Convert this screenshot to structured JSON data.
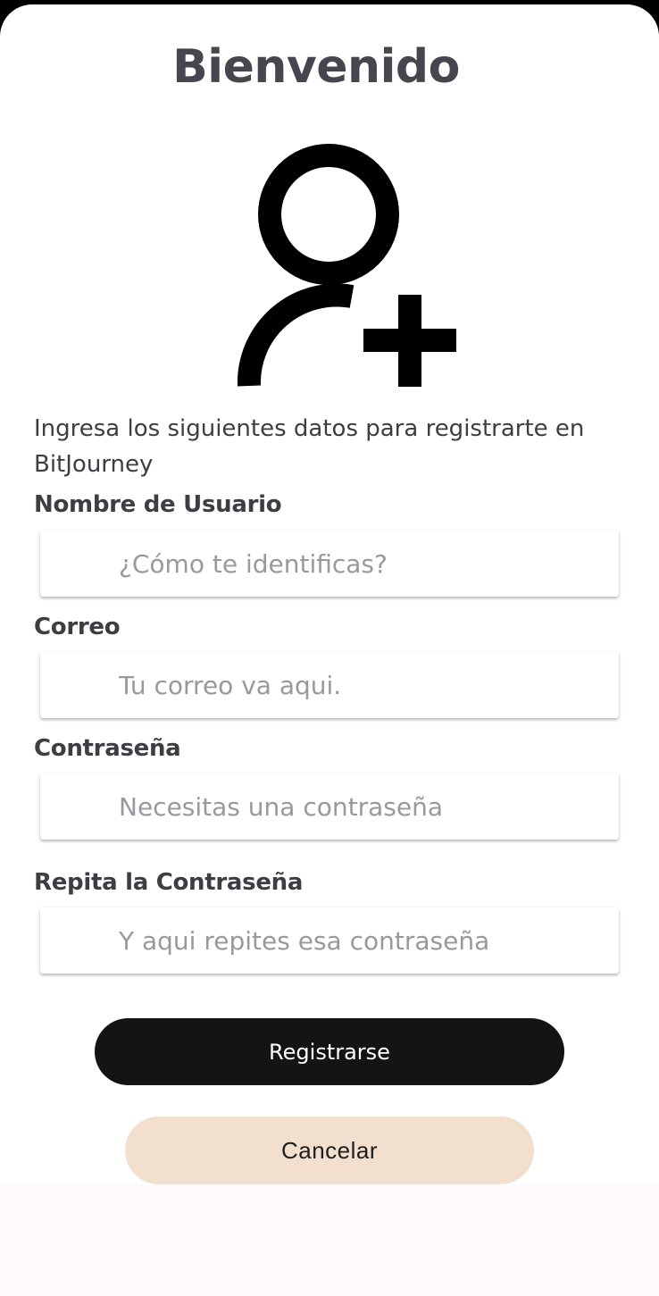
{
  "header": {
    "title": "Bienvenido"
  },
  "icon": {
    "name": "add-user-icon"
  },
  "intro_text": "Ingresa los siguientes datos para registrarte en BitJourney",
  "form": {
    "username": {
      "label": "Nombre de Usuario",
      "placeholder": "¿Cómo te identificas?",
      "value": ""
    },
    "email": {
      "label": "Correo",
      "placeholder": "Tu correo va aqui.",
      "value": ""
    },
    "password": {
      "label": "Contraseña",
      "placeholder": "Necesitas una contraseña",
      "value": ""
    },
    "password_repeat": {
      "label": "Repita la Contraseña",
      "placeholder": "Y aqui repites esa contraseña",
      "value": ""
    }
  },
  "actions": {
    "register_label": "Registrarse",
    "cancel_label": "Cancelar"
  },
  "colors": {
    "primary_button": "#141414",
    "secondary_button": "#f2dfcd",
    "title_text": "#48454e"
  }
}
